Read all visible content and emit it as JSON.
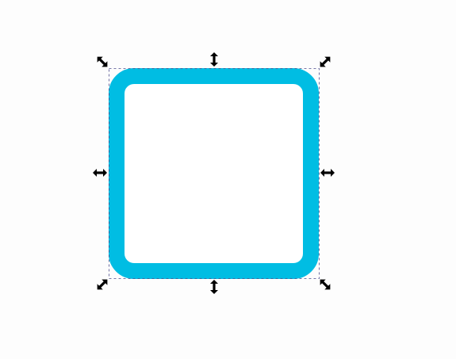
{
  "canvas": {
    "background": "#fdfdfd"
  },
  "shape": {
    "type": "rounded-rectangle",
    "stroke_color": "#00bde3",
    "fill_color": "#ffffff",
    "selected": true
  },
  "selection": {
    "bbox_dash_color": "#4a4a8a",
    "handle_color": "#000000",
    "handles": [
      {
        "name": "resize-handle-top-left",
        "icon": "diagonal-double-arrow-icon"
      },
      {
        "name": "resize-handle-top",
        "icon": "vertical-double-arrow-icon"
      },
      {
        "name": "resize-handle-top-right",
        "icon": "diagonal-double-arrow-icon"
      },
      {
        "name": "resize-handle-left",
        "icon": "horizontal-double-arrow-icon"
      },
      {
        "name": "resize-handle-right",
        "icon": "horizontal-double-arrow-icon"
      },
      {
        "name": "resize-handle-bottom-left",
        "icon": "diagonal-double-arrow-icon"
      },
      {
        "name": "resize-handle-bottom",
        "icon": "vertical-double-arrow-icon"
      },
      {
        "name": "resize-handle-bottom-right",
        "icon": "diagonal-double-arrow-icon"
      }
    ]
  }
}
